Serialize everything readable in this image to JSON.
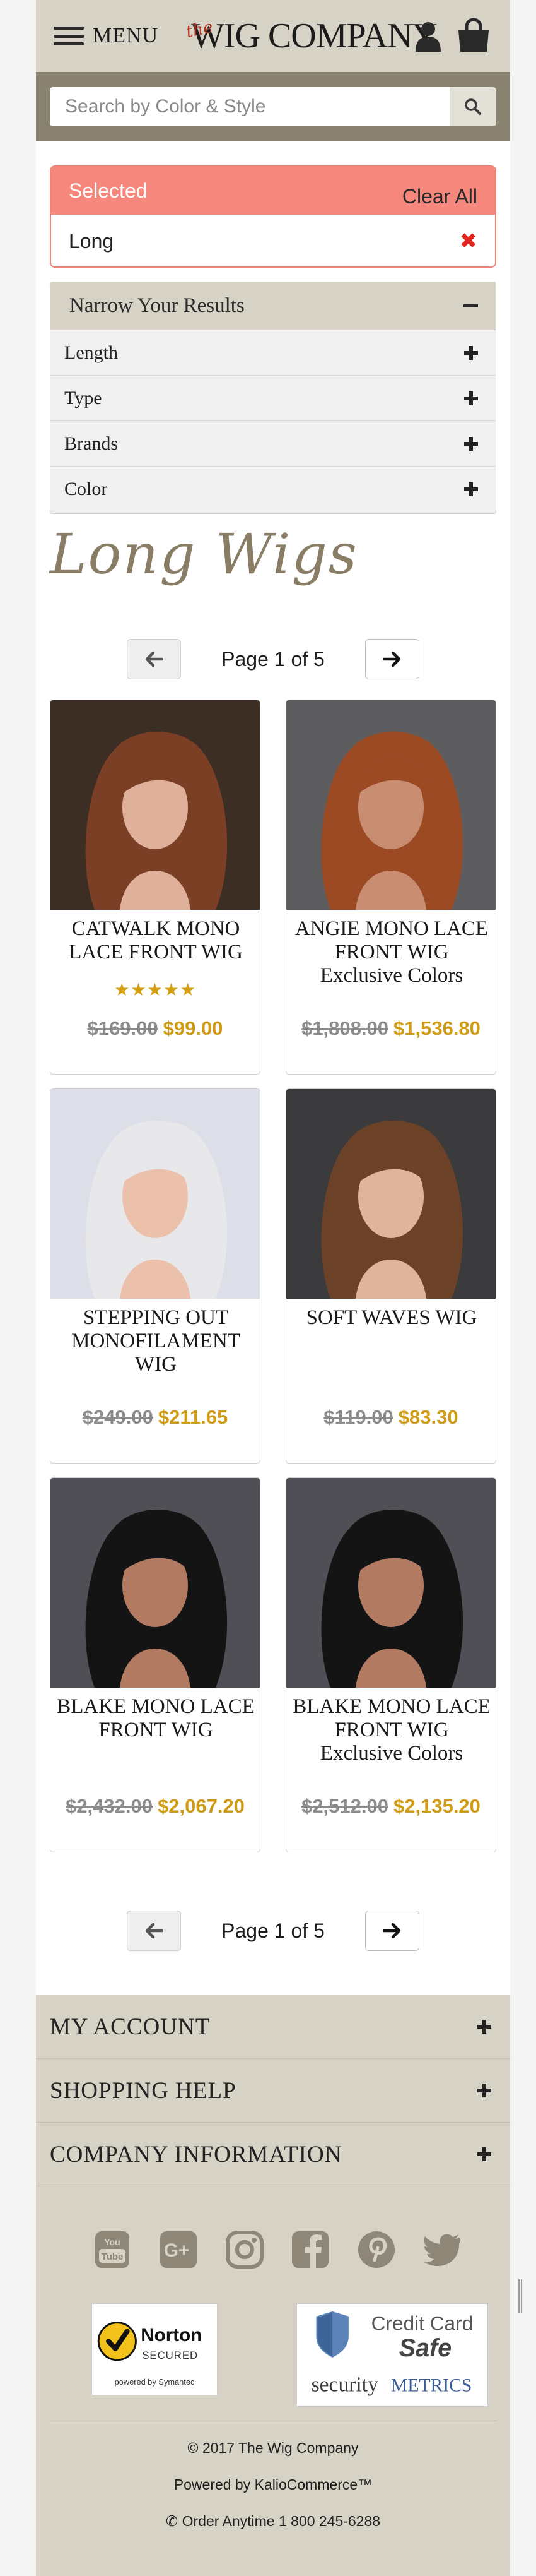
{
  "header": {
    "menu_label": "MENU",
    "logo_the": "the",
    "logo_name": "WIG COMPANY"
  },
  "search": {
    "placeholder": "Search by Color & Style"
  },
  "selected": {
    "title": "Selected",
    "clear_label": "Clear All",
    "items": [
      {
        "label": "Long"
      }
    ]
  },
  "narrow": {
    "title": "Narrow Your Results",
    "facets": [
      {
        "label": "Length"
      },
      {
        "label": "Type"
      },
      {
        "label": "Brands"
      },
      {
        "label": "Color"
      }
    ]
  },
  "page_title": "Long Wigs",
  "pagination": {
    "text": "Page 1 of 5",
    "prev_icon": "arrow-left-icon",
    "next_icon": "arrow-right-icon"
  },
  "products": [
    {
      "name": "CATWALK MONO LACE FRONT WIG",
      "rating": 5,
      "rating_text": "★★★★★",
      "old_price": "$169.00",
      "new_price": "$99.00",
      "hair_color": "#7a3f24",
      "bg_color": "#3c2e25",
      "skin_color": "#dfb19b"
    },
    {
      "name": "ANGIE MONO LACE FRONT WIG Exclusive Colors",
      "rating": null,
      "rating_text": "",
      "old_price": "$1,808.00",
      "new_price": "$1,536.80",
      "hair_color": "#9b4a24",
      "bg_color": "#5d5d60",
      "skin_color": "#c98e72"
    },
    {
      "name": "STEPPING OUT MONOFILAMENT WIG",
      "rating": null,
      "rating_text": "",
      "old_price": "$249.00",
      "new_price": "$211.65",
      "hair_color": "#e8e8ea",
      "bg_color": "#dcdfe8",
      "skin_color": "#ecc1ab"
    },
    {
      "name": "SOFT WAVES WIG",
      "rating": null,
      "rating_text": "",
      "old_price": "$119.00",
      "new_price": "$83.30",
      "hair_color": "#6b4128",
      "bg_color": "#3b3b3d",
      "skin_color": "#e0b49b"
    },
    {
      "name": "BLAKE MONO LACE FRONT WIG",
      "rating": null,
      "rating_text": "",
      "old_price": "$2,432.00",
      "new_price": "$2,067.20",
      "hair_color": "#141414",
      "bg_color": "#504f55",
      "skin_color": "#b37a62"
    },
    {
      "name": "BLAKE MONO LACE FRONT WIG Exclusive Colors",
      "rating": null,
      "rating_text": "",
      "old_price": "$2,512.00",
      "new_price": "$2,135.20",
      "hair_color": "#141414",
      "bg_color": "#504f55",
      "skin_color": "#b37a62"
    }
  ],
  "footer": {
    "links": [
      {
        "label": "MY ACCOUNT"
      },
      {
        "label": "SHOPPING HELP"
      },
      {
        "label": "COMPANY INFORMATION"
      }
    ],
    "social_icons": [
      "youtube-icon",
      "google-plus-icon",
      "instagram-icon",
      "facebook-icon",
      "pinterest-icon",
      "twitter-icon"
    ],
    "norton": {
      "line1": "Norton",
      "line2": "SECURED",
      "line3": "powered by Symantec"
    },
    "metrics": {
      "line1": "Credit Card",
      "line2": "Safe",
      "line3": "security",
      "line4": "METRICS"
    },
    "copyright": "© 2017 The Wig Company",
    "powered": "Powered by KalioCommerce™",
    "order_phone": "Order Anytime 1 800 245-6288"
  },
  "colors": {
    "header_bg": "#d6d2c5",
    "search_band": "#8a8270",
    "selected_accent": "#f5877c",
    "price_accent": "#cf9a14",
    "title_accent": "#8a7d66"
  }
}
